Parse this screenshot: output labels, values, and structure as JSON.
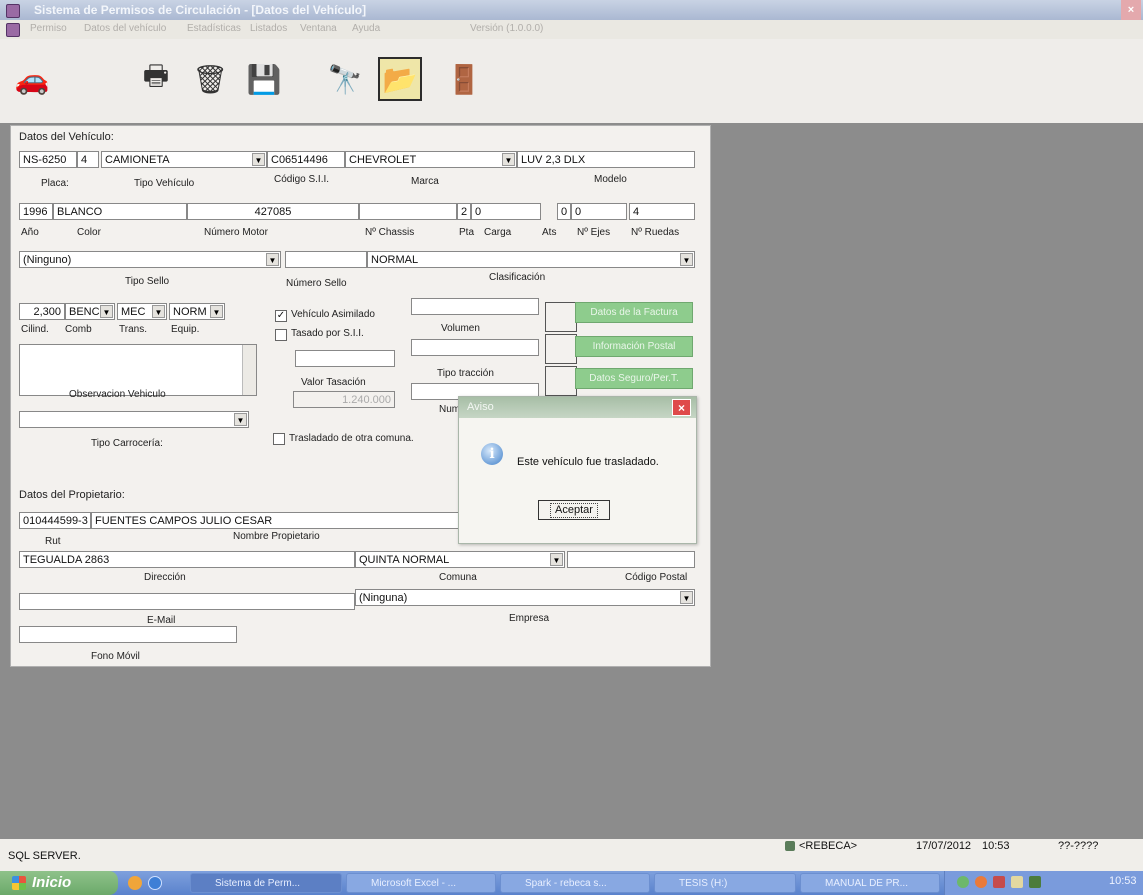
{
  "window": {
    "title": "Sistema de Permisos de Circulación - [Datos del Vehículo]",
    "close": "×"
  },
  "menu": [
    "Permiso",
    "Datos del vehículo",
    "Estadísticas",
    "Listados",
    "Ventana",
    "Ayuda"
  ],
  "menu_version": "Versión (1.0.0.0)",
  "toolbar": [
    {
      "name": "car-icon",
      "glyph": "🚗"
    },
    {
      "name": "printer-icon",
      "glyph": "🖶"
    },
    {
      "name": "trash-icon",
      "glyph": "🗑"
    },
    {
      "name": "save-icon",
      "glyph": "💾"
    },
    {
      "name": "binoculars-icon",
      "glyph": "🔭"
    },
    {
      "name": "folder-icon",
      "glyph": "📂"
    },
    {
      "name": "door-exit-icon",
      "glyph": "🚪"
    }
  ],
  "vehicle": {
    "section": "Datos del Vehículo:",
    "placa": "NS-6250",
    "dv": "4",
    "tipo": "CAMIONETA",
    "codigo_sii": "C06514496",
    "marca": "CHEVROLET",
    "modelo": "LUV 2,3 DLX",
    "lbl_placa": "Placa:",
    "lbl_tipo": "Tipo Vehículo",
    "lbl_codigo": "Código S.I.I.",
    "lbl_marca": "Marca",
    "lbl_modelo": "Modelo",
    "anio": "1996",
    "color": "BLANCO",
    "motor": "427085",
    "chassis": "",
    "pta": "2",
    "carga": "0",
    "ats": "0",
    "ejes": "0",
    "ruedas": "4",
    "lbl_anio": "Año",
    "lbl_color": "Color",
    "lbl_motor": "Número Motor",
    "lbl_chassis": "Nº Chassis",
    "lbl_pta": "Pta",
    "lbl_carga": "Carga",
    "lbl_ats": "Ats",
    "lbl_ejes": "Nº Ejes",
    "lbl_ruedas": "Nº Ruedas",
    "tipo_sello": "(Ninguno)",
    "numero_sello": "",
    "clasificacion": "NORMAL",
    "lbl_tipo_sello": "Tipo Sello",
    "lbl_numero_sello": "Número Sello",
    "lbl_clasificacion": "Clasificación",
    "cilindrada": "2,300",
    "comb": "BENC",
    "trans": "MEC",
    "equip": "NORM",
    "lbl_cilind": "Cilind.",
    "lbl_comb": "Comb",
    "lbl_trans": "Trans.",
    "lbl_equip": "Equip.",
    "chk_asimilado": "Vehículo Asimilado",
    "chk_tasado": "Tasado por S.I.I.",
    "valor_tasacion": "1.240.000",
    "lbl_valor_tasacion": "Valor Tasación",
    "lbl_volumen": "Volumen",
    "lbl_tipo_traccion": "Tipo tracción",
    "lbl_num": "Num",
    "btn_factura": "Datos de la Factura",
    "btn_postal": "Información Postal",
    "btn_seguro": "Datos Seguro/Per.T.",
    "lbl_observacion": "Observacion Vehiculo",
    "lbl_carroceria": "Tipo Carrocería:",
    "chk_trasladado": "Trasladado de otra comuna."
  },
  "owner": {
    "section": "Datos del Propietario:",
    "rut": "010444599-3",
    "nombre": "FUENTES CAMPOS JULIO CESAR",
    "lbl_rut": "Rut",
    "lbl_nombre": "Nombre Propietario",
    "direccion": "TEGUALDA 2863",
    "comuna": "QUINTA NORMAL",
    "codigo_postal": "",
    "lbl_direccion": "Dirección",
    "lbl_comuna": "Comuna",
    "lbl_codigo_postal": "Código Postal",
    "email": "",
    "empresa": "(Ninguna)",
    "lbl_email": "E-Mail",
    "lbl_empresa": "Empresa",
    "fono": "",
    "lbl_fono": "Fono Móvil"
  },
  "dialog": {
    "title": "Aviso",
    "message": "Este vehículo fue trasladado.",
    "button": "Aceptar",
    "close": "×",
    "icon": "i"
  },
  "status": {
    "db": "SQL SERVER.",
    "user": "<REBECA>",
    "date": "17/07/2012",
    "time": "10:53",
    "extra": "??-????"
  },
  "taskbar": {
    "start": "Inicio",
    "items": [
      "Sistema de Perm...",
      "Microsoft Excel - ...",
      "Spark - rebeca s...",
      "TESIS (H:)",
      "MANUAL DE PR..."
    ],
    "clock": "10:53"
  },
  "colors": {
    "green_button": "#8ecc8d",
    "dialog_close": "#df4a4a",
    "desktop": "#8c8c8c"
  }
}
